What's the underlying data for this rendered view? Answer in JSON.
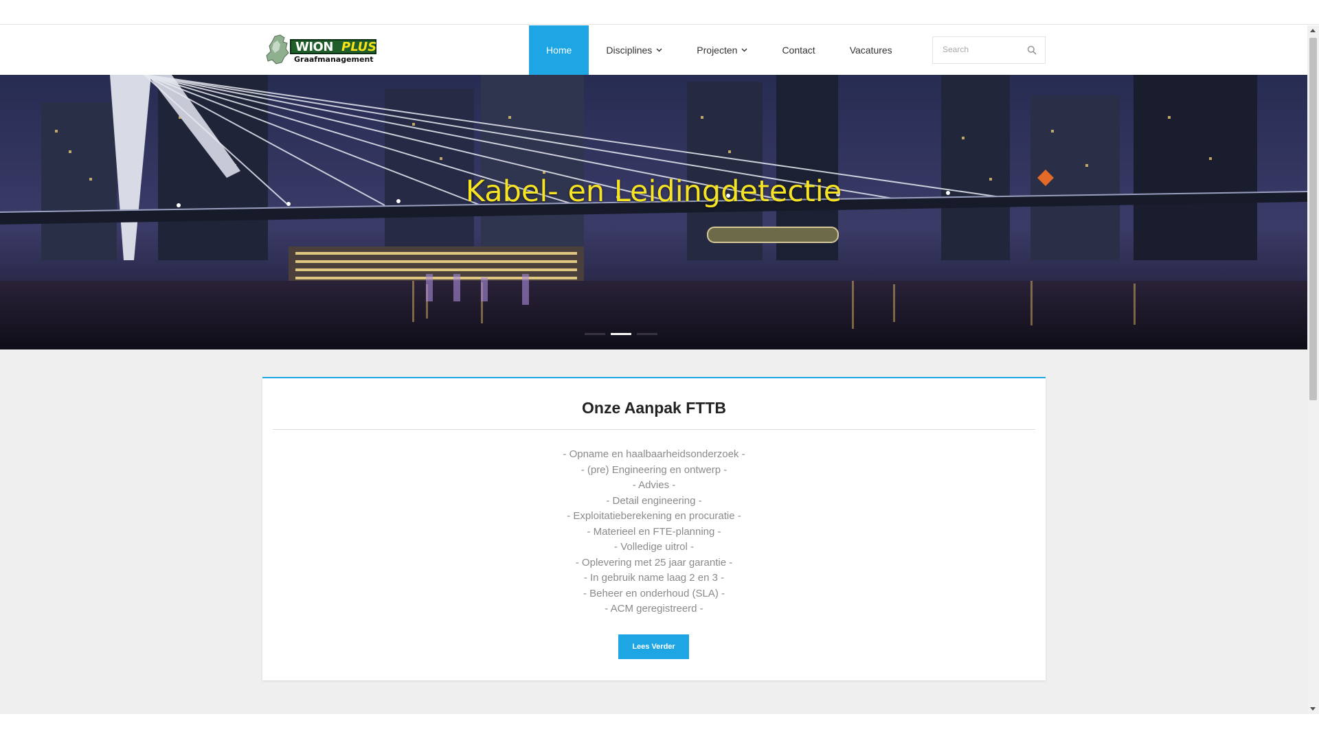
{
  "header": {
    "logo": {
      "brand_main": "WION",
      "brand_accent": "PLUS",
      "tagline": "Graafmanagement"
    },
    "nav": [
      {
        "label": "Home",
        "active": true,
        "has_dropdown": false
      },
      {
        "label": "Disciplines",
        "active": false,
        "has_dropdown": true
      },
      {
        "label": "Projecten",
        "active": false,
        "has_dropdown": true
      },
      {
        "label": "Contact",
        "active": false,
        "has_dropdown": false
      },
      {
        "label": "Vacatures",
        "active": false,
        "has_dropdown": false
      }
    ],
    "search": {
      "placeholder": "Search",
      "icon": "search-icon"
    }
  },
  "hero": {
    "title": "Kabel- en Leidingdetectie",
    "slides_total": 3,
    "active_slide": 2
  },
  "card": {
    "title": "Onze Aanpak FTTB",
    "items": [
      "- Opname en haalbaarheidsonderzoek -",
      "- (pre) Engineering en ontwerp -",
      "- Advies -",
      "- Detail engineering -",
      "- Exploitatieberekening en procuratie -",
      "- Materieel en FTE-planning -",
      "- Volledige uitrol -",
      "- Oplevering met 25 jaar garantie -",
      "- In gebruik name laag 2 en 3 -",
      "- Beheer en onderhoud (SLA) -",
      "- ACM geregistreerd -"
    ],
    "button_label": "Lees Verder"
  },
  "colors": {
    "accent": "#1ea5e3",
    "hero_title": "#f6e324",
    "logo_green": "#1f5d2b",
    "logo_yellow": "#f7e21a"
  }
}
